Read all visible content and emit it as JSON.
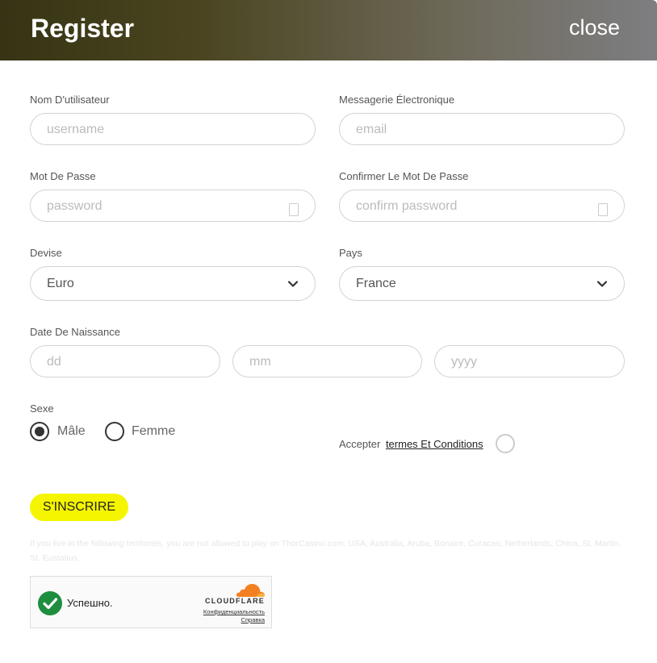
{
  "header": {
    "title": "Register",
    "close_label": "close"
  },
  "form": {
    "username": {
      "label": "Nom D'utilisateur",
      "placeholder": "username"
    },
    "email": {
      "label": "Messagerie Électronique",
      "placeholder": "email"
    },
    "password": {
      "label": "Mot De Passe",
      "placeholder": "password"
    },
    "confirm_password": {
      "label": "Confirmer Le Mot De Passe",
      "placeholder": "confirm password"
    },
    "currency": {
      "label": "Devise",
      "value": "Euro"
    },
    "country": {
      "label": "Pays",
      "value": "France"
    },
    "birthdate": {
      "label": "Date De Naissance",
      "day_placeholder": "dd",
      "month_placeholder": "mm",
      "year_placeholder": "yyyy"
    },
    "gender": {
      "label": "Sexe",
      "options": [
        "Mâle",
        "Femme"
      ],
      "selected": "Mâle"
    },
    "terms": {
      "prefix": "Accepter",
      "link_text": "termes Et Conditions",
      "accepted": false
    },
    "submit_label": "S'INSCRIRE"
  },
  "disclaimer": "If you live in the following territories, you are not allowed to play on ThorCasino.com: USA, Australia, Aruba, Bonaire, Curacao, Netherlands, China, St. Martin, St. Eustatius.",
  "captcha": {
    "status": "Успешно.",
    "brand": "CLOUDFLARE",
    "privacy_link": "Конфиденциальность",
    "help_link": "Справка"
  },
  "colors": {
    "submit_bg": "#f5f500",
    "success_green": "#1e8e3e",
    "cloudflare_orange": "#f38020"
  }
}
